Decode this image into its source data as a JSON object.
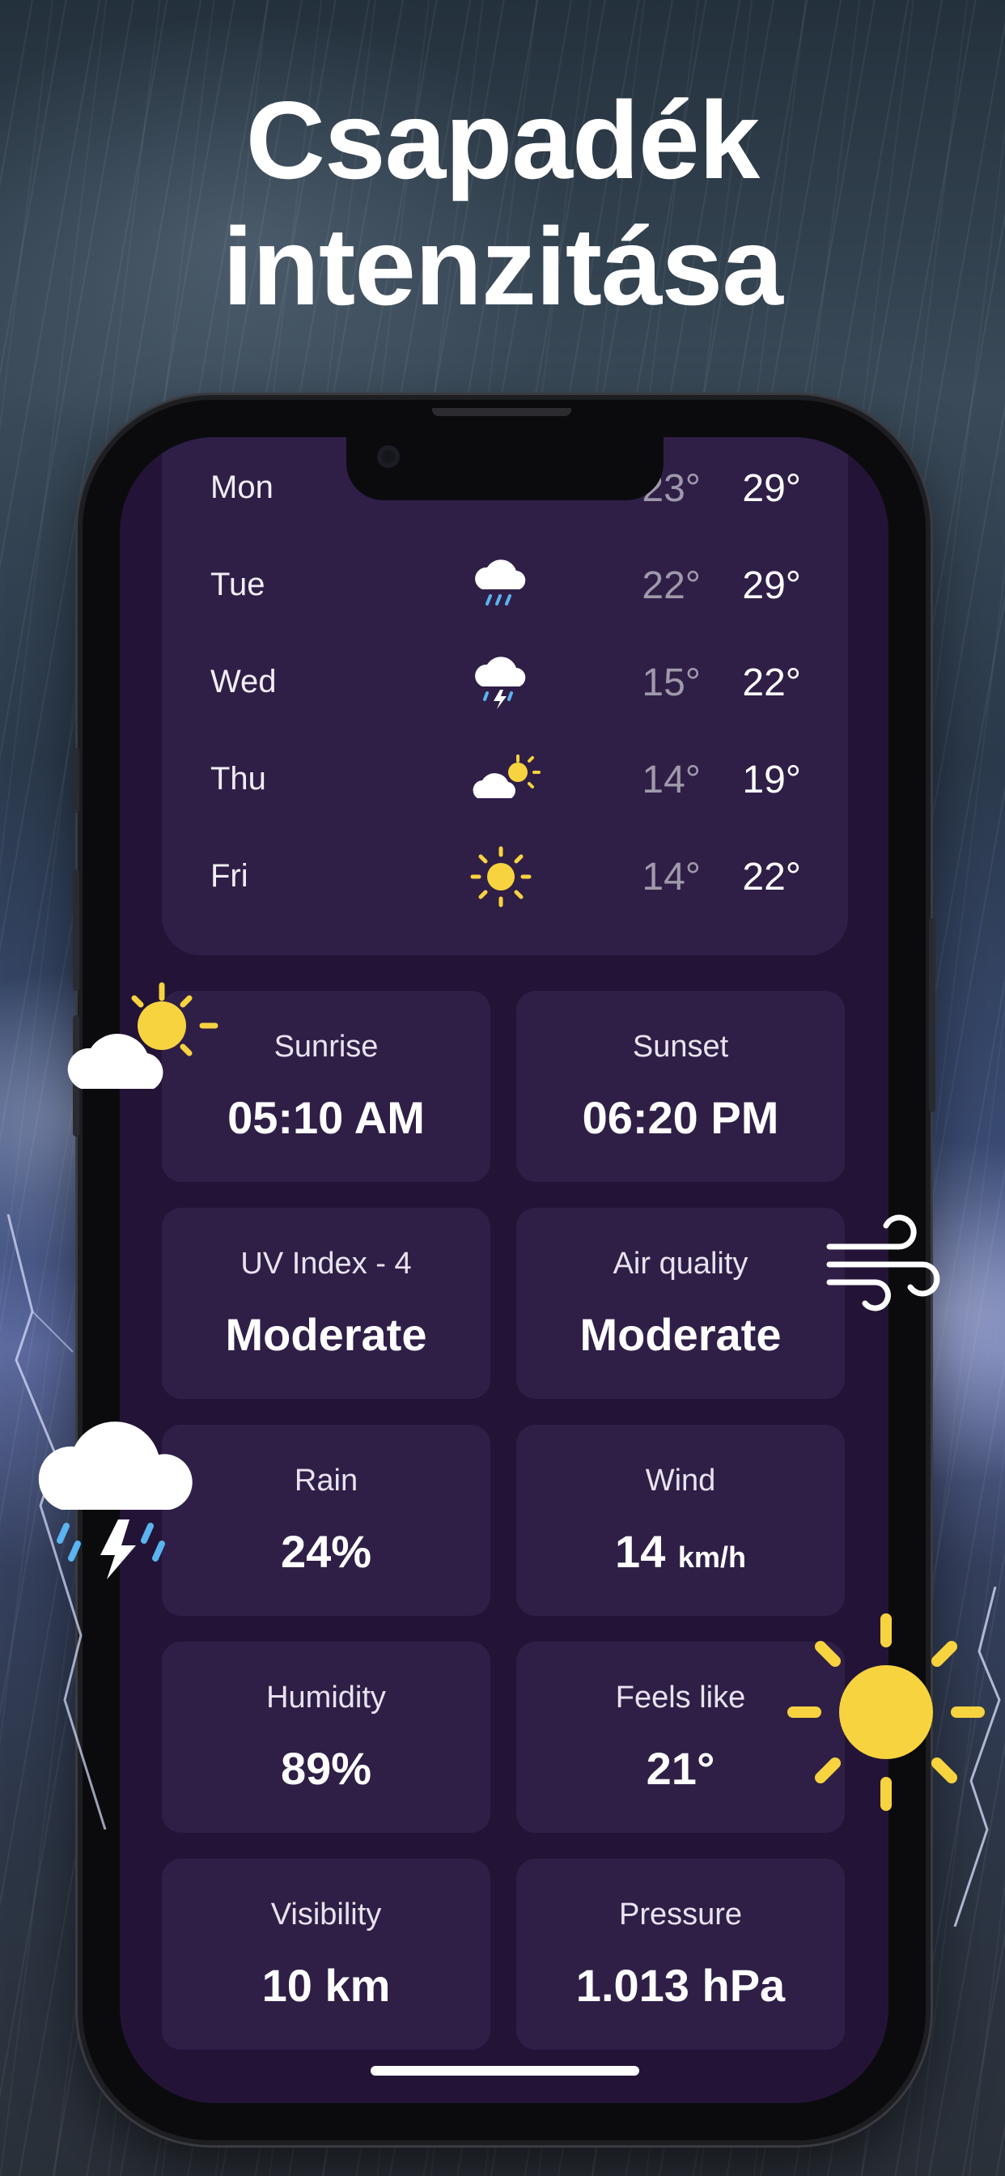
{
  "headline": {
    "line1": "Csapadék",
    "line2": "intenzitása"
  },
  "forecast": [
    {
      "day": "Mon",
      "icon": "sun-icon",
      "low": "23°",
      "high": "29°"
    },
    {
      "day": "Tue",
      "icon": "rain-cloud-icon",
      "low": "22°",
      "high": "29°"
    },
    {
      "day": "Wed",
      "icon": "thunderstorm-icon",
      "low": "15°",
      "high": "22°"
    },
    {
      "day": "Thu",
      "icon": "partly-cloudy-icon",
      "low": "14°",
      "high": "19°"
    },
    {
      "day": "Fri",
      "icon": "sun-icon",
      "low": "14°",
      "high": "22°"
    }
  ],
  "cards": {
    "sunrise": {
      "label": "Sunrise",
      "value": "05:10 AM"
    },
    "sunset": {
      "label": "Sunset",
      "value": "06:20 PM"
    },
    "uv": {
      "label": "UV Index - 4",
      "value": "Moderate"
    },
    "air": {
      "label": "Air quality",
      "value": "Moderate"
    },
    "rain": {
      "label": "Rain",
      "value": "24%"
    },
    "wind": {
      "label": "Wind",
      "value": "14",
      "unit": "km/h"
    },
    "humidity": {
      "label": "Humidity",
      "value": "89%"
    },
    "feels": {
      "label": "Feels like",
      "value": "21°"
    },
    "visibility": {
      "label": "Visibility",
      "value": "10 km"
    },
    "pressure": {
      "label": "Pressure",
      "value": "1.013 hPa"
    }
  },
  "colors": {
    "screen_bg": "#231437",
    "card_bg": "#2f1f47",
    "sun": "#f7d33f",
    "rain_drop": "#5ab4f0"
  }
}
